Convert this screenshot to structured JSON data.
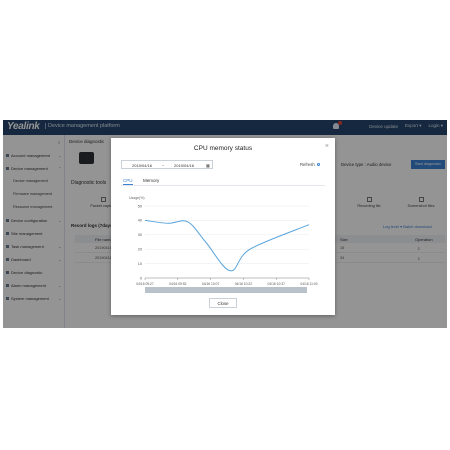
{
  "topbar": {
    "logo": "Yealink",
    "platform_title": "Device management platform",
    "device_update": "Device update",
    "export": "Export ▾",
    "login": "Login ▾"
  },
  "sidebar": {
    "items": [
      {
        "label": "Account management"
      },
      {
        "label": "Device management"
      },
      {
        "label": "Device configuration"
      },
      {
        "label": "Site management"
      },
      {
        "label": "Task management"
      },
      {
        "label": "Dashboard"
      },
      {
        "label": "Device diagnostic"
      },
      {
        "label": "Alarm management"
      },
      {
        "label": "System management"
      }
    ],
    "subitems": [
      {
        "label": "Device management"
      },
      {
        "label": "Firmware management"
      },
      {
        "label": "Resource management"
      }
    ]
  },
  "main": {
    "breadcrumb": "Device diagnostic",
    "device_type": "Device type : Audio device",
    "start_diagnostic": "Start diagnostic",
    "diagnostic_tools": "Diagnostic tools",
    "tools": [
      {
        "label": "Packet capture"
      },
      {
        "label": "Recording file"
      },
      {
        "label": "Screenshot files"
      }
    ],
    "recent_logs": "Record logs (7days)",
    "log_links": "Log level ▾   Batch download",
    "table_headers": {
      "file_name": "File name",
      "size": "Size",
      "operation": "Operation"
    },
    "rows": [
      {
        "file": "20190418-log.tar",
        "size": "15"
      },
      {
        "file": "20190418-log.tar",
        "size": "34"
      }
    ]
  },
  "modal": {
    "title": "CPU memory status",
    "date_start": "2019/04/16",
    "date_sep": "~",
    "date_end": "2019/04/16",
    "refresh_label": "Refresh",
    "tabs": [
      {
        "label": "CPU"
      },
      {
        "label": "Memory"
      }
    ],
    "close_label": "Close",
    "close_x": "×"
  },
  "colors": {
    "topbar": "#25466e",
    "accent": "#3b82d6",
    "line": "#5aa5dc"
  },
  "chart_data": {
    "type": "line",
    "ylabel": "Usage(%)",
    "ylim": [
      0,
      50
    ],
    "yticks": [
      0,
      10,
      20,
      30,
      40,
      50
    ],
    "categories": [
      "04/16 09:27",
      "04/16 09:52",
      "04/16 10:07",
      "04/16 10:22",
      "04/16 10:37",
      "04/16 11:00"
    ],
    "x": [
      0,
      0.7,
      1.3,
      1.85,
      2.6,
      3.2,
      5
    ],
    "values": [
      40,
      38,
      39,
      25,
      5,
      20,
      37
    ],
    "grid": true
  }
}
